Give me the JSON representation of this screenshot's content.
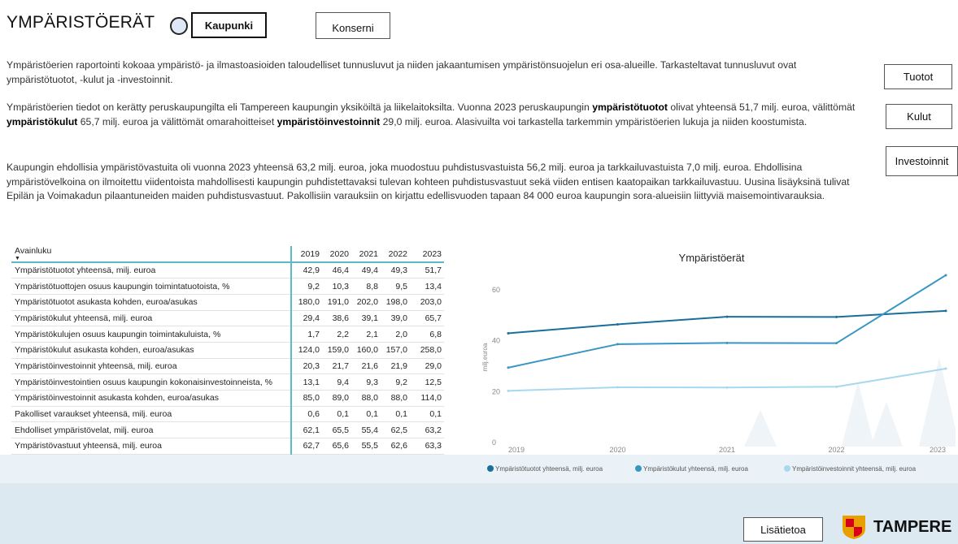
{
  "header": {
    "title": "YMPÄRISTÖERÄT",
    "tab_kaupunki": "Kaupunki",
    "tab_konserni": "Konserni"
  },
  "side_buttons": {
    "tuotot": "Tuotot",
    "kulut": "Kulut",
    "investoinnit": "Investoinnit"
  },
  "intro": {
    "p1": "Ympäristöerien raportointi kokoaa ympäristö- ja ilmastoasioiden taloudelliset tunnusluvut ja niiden jakaantumisen ympäristönsuojelun eri osa-alueille. Tarkasteltavat tunnusluvut ovat ympäristötuotot, -kulut ja -investoinnit.",
    "p2_a": "Ympäristöerien tiedot on kerätty peruskaupungilta eli Tampereen kaupungin yksiköiltä ja liikelaitoksilta. Vuonna 2023 peruskaupungin ",
    "p2_b1": "ympäristötuotot",
    "p2_c": " olivat yhteensä 51,7 milj. euroa, välittömät ",
    "p2_b2": "ympäristökulut",
    "p2_d": " 65,7 milj. euroa ja välittömät omarahoitteiset ",
    "p2_b3": "ympäristöinvestoinnit",
    "p2_e": " 29,0 milj. euroa. Alasivuilta voi tarkastella tarkemmin ympäristöerien lukuja ja niiden koostumista.",
    "p3": "Kaupungin ehdollisia ympäristövastuita oli vuonna 2023 yhteensä 63,2 milj. euroa, joka muodostuu puhdistusvastuista 56,2 milj. euroa ja tarkkailuvastuista 7,0 milj. euroa. Ehdollisina ympäristövelkoina on ilmoitettu viidentoista mahdollisesti kaupungin puhdistettavaksi tulevan kohteen puhdistusvastuut sekä viiden entisen kaatopaikan tarkkailuvastuu. Uusina lisäyksinä tulivat Epilän ja Voimakadun pilaantuneiden maiden puhdistusvastuut. Pakollisiin varauksiin on kirjattu edellisvuoden tapaan 84 000 euroa kaupungin sora-alueisiin liittyviä maisemointivarauksia."
  },
  "table": {
    "header_label": "Avainluku",
    "years": [
      "2019",
      "2020",
      "2021",
      "2022",
      "2023"
    ],
    "rows": [
      {
        "label": "Ympäristötuotot yhteensä, milj. euroa",
        "values": [
          "42,9",
          "46,4",
          "49,4",
          "49,3",
          "51,7"
        ]
      },
      {
        "label": "Ympäristötuottojen osuus kaupungin toimintatuotoista, %",
        "values": [
          "9,2",
          "10,3",
          "8,8",
          "9,5",
          "13,4"
        ]
      },
      {
        "label": "Ympäristötuotot asukasta kohden, euroa/asukas",
        "values": [
          "180,0",
          "191,0",
          "202,0",
          "198,0",
          "203,0"
        ]
      },
      {
        "label": "Ympäristökulut yhteensä, milj. euroa",
        "values": [
          "29,4",
          "38,6",
          "39,1",
          "39,0",
          "65,7"
        ]
      },
      {
        "label": "Ympäristökulujen osuus kaupungin toimintakuluista, %",
        "values": [
          "1,7",
          "2,2",
          "2,1",
          "2,0",
          "6,8"
        ]
      },
      {
        "label": "Ympäristökulut asukasta kohden, euroa/asukas",
        "values": [
          "124,0",
          "159,0",
          "160,0",
          "157,0",
          "258,0"
        ]
      },
      {
        "label": "Ympäristöinvestoinnit yhteensä, milj. euroa",
        "values": [
          "20,3",
          "21,7",
          "21,6",
          "21,9",
          "29,0"
        ]
      },
      {
        "label": "Ympäristöinvestointien osuus kaupungin kokonaisinvestoinneista, %",
        "values": [
          "13,1",
          "9,4",
          "9,3",
          "9,2",
          "12,5"
        ]
      },
      {
        "label": "Ympäristöinvestoinnit asukasta kohden, euroa/asukas",
        "values": [
          "85,0",
          "89,0",
          "88,0",
          "88,0",
          "114,0"
        ]
      },
      {
        "label": "Pakolliset varaukset yhteensä, milj. euroa",
        "values": [
          "0,6",
          "0,1",
          "0,1",
          "0,1",
          "0,1"
        ]
      },
      {
        "label": "Ehdolliset ympäristövelat, milj. euroa",
        "values": [
          "62,1",
          "65,5",
          "55,4",
          "62,5",
          "63,2"
        ]
      },
      {
        "label": "Ympäristövastuut yhteensä, milj. euroa",
        "values": [
          "62,7",
          "65,6",
          "55,5",
          "62,6",
          "63,3"
        ]
      }
    ]
  },
  "chart_data": {
    "type": "line",
    "title": "Ympäristöerät",
    "xlabel": "",
    "ylabel": "milj.euroa",
    "x": [
      2019,
      2020,
      2021,
      2022,
      2023
    ],
    "ylim": [
      0,
      66
    ],
    "yticks": [
      0,
      20,
      40,
      60
    ],
    "grid": false,
    "legend_position": "bottom",
    "series": [
      {
        "name": "Ympäristötuotot yhteensä, milj. euroa",
        "color": "#1a6e9a",
        "values": [
          42.9,
          46.4,
          49.4,
          49.3,
          51.7
        ]
      },
      {
        "name": "Ympäristökulut yhteensä, milj. euroa",
        "color": "#3796c4",
        "values": [
          29.4,
          38.6,
          39.1,
          39.0,
          65.7
        ]
      },
      {
        "name": "Ympäristöinvestoinnit yhteensä, milj. euroa",
        "color": "#a8d8ee",
        "values": [
          20.3,
          21.7,
          21.6,
          21.9,
          29.0
        ]
      }
    ]
  },
  "footer": {
    "more_button": "Lisätietoa",
    "logo_text": "TAMPERE"
  }
}
